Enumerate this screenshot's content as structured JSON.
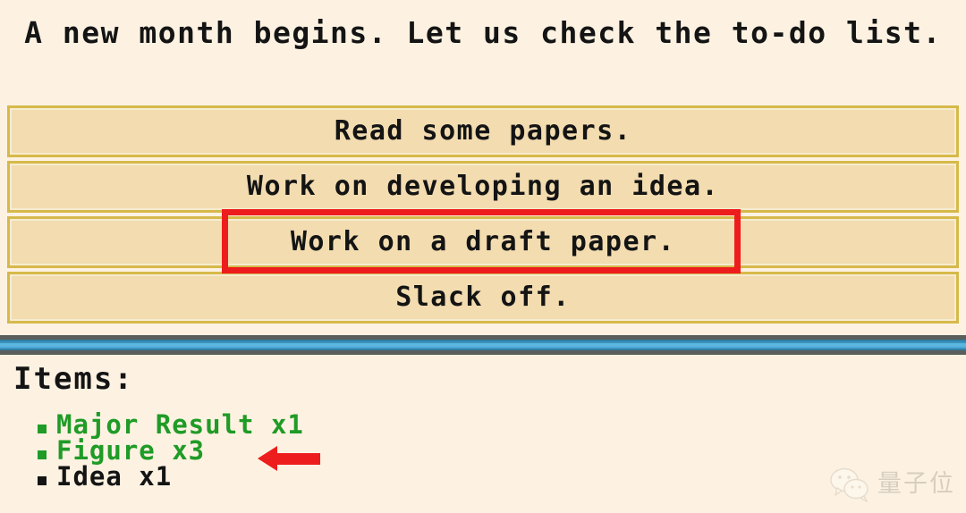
{
  "scene": {
    "background_color": "#fdf2e2",
    "prompt_text": "A new month begins. Let us check the to-do list."
  },
  "menu": {
    "options": [
      {
        "label": "Read some papers.",
        "highlighted": "false"
      },
      {
        "label": "Work on developing an idea.",
        "highlighted": "false"
      },
      {
        "label": "Work on a draft paper.",
        "highlighted": "true"
      },
      {
        "label": "Slack off.",
        "highlighted": "false"
      }
    ],
    "box_fill_color": "#f2dcb0",
    "box_border_color": "#d6b94a",
    "highlight_color": "#ee1d1d"
  },
  "divider": {
    "top_edge_color": "#5a5f5c",
    "center_color": "#5bb6e0"
  },
  "inventory": {
    "title": "Items:",
    "items": [
      {
        "text": "Major Result x1",
        "color": "#1f9b26",
        "bullet_color": "#1f9b26"
      },
      {
        "text": "Figure x3",
        "color": "#1f9b26",
        "bullet_color": "#1f9b26"
      },
      {
        "text": "Idea x1",
        "color": "#141414",
        "bullet_color": "#141414"
      }
    ]
  },
  "annotations": {
    "highlight_target": "Work on a draft paper.",
    "arrow_target": "Figure x3",
    "arrow_color": "#ee1d1d",
    "arrow_direction": "left"
  },
  "watermark": {
    "text": "量子位",
    "icon": "wechat-icon"
  }
}
